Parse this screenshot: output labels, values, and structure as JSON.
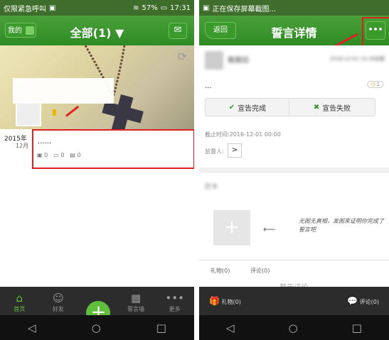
{
  "left": {
    "status": {
      "left_text": "仅限紧急呼叫",
      "battery": "57%",
      "time": "17:31"
    },
    "header": {
      "mine_label": "我的",
      "title": "全部(1) ▼"
    },
    "feed": {
      "year": "2015年",
      "month": "12月",
      "text": "......",
      "stat_photos": "0",
      "stat_comments": "0",
      "stat_gifts": "0"
    },
    "tabs": [
      {
        "label": "首页",
        "icon": "home-icon"
      },
      {
        "label": "好友",
        "icon": "friends-icon"
      },
      {
        "label": "",
        "icon": "add-icon"
      },
      {
        "label": "誓言墙",
        "icon": "grid-icon"
      },
      {
        "label": "更多",
        "icon": "more-icon"
      }
    ]
  },
  "right": {
    "status": {
      "left_text": "正在保存屏幕截图...",
      "time": ""
    },
    "header": {
      "back_label": "返回",
      "title": "誓言详情",
      "more_label": "•••"
    },
    "post": {
      "username": "搬搬招",
      "created": "2016-12-01 15:26创建",
      "text": "...",
      "likes": "1"
    },
    "actions": {
      "complete_label": "宣告完成",
      "fail_label": "宣告失败"
    },
    "deadline": "截止时间:2016-12-01 00:00",
    "supervisor_label": "监督人:",
    "section_label": "打卡",
    "hint_text": "无图无真相，发图来证明你完成了誓言吧",
    "tabs": {
      "gifts": "礼物(0)",
      "comments": "评论(0)"
    },
    "empty_text": "暂无评论",
    "bottom": {
      "gift_label": "礼物(0)",
      "comment_label": "评论(0)"
    }
  },
  "colors": {
    "green": "#3b9a2c",
    "red": "#e02020"
  }
}
